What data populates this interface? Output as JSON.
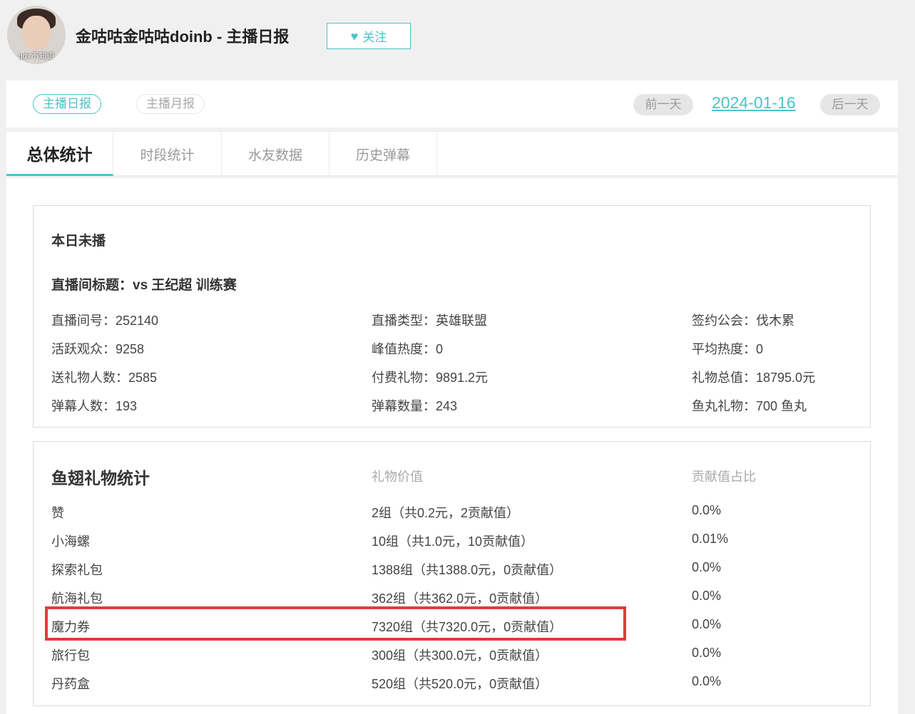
{
  "header": {
    "avatar_caption": "gdx不知道",
    "streamer_title": "金咕咕金咕咕doinb - 主播日报",
    "follow_label": "关注",
    "follow_icon": "heart-icon"
  },
  "report_bar": {
    "daily_tab": "主播日报",
    "monthly_tab": "主播月报",
    "prev_day": "前一天",
    "date": "2024-01-16",
    "next_day": "后一天"
  },
  "tabs": [
    {
      "label": "总体统计",
      "active": true
    },
    {
      "label": "时段统计",
      "active": false
    },
    {
      "label": "水友数据",
      "active": false
    },
    {
      "label": "历史弹幕",
      "active": false
    }
  ],
  "overview": {
    "status": "本日未播",
    "room_title": "直播间标题：vs 王纪超 训练赛",
    "stats": [
      [
        "直播间号：252140",
        "直播类型：英雄联盟",
        "签约公会：伐木累"
      ],
      [
        "活跃观众：9258",
        "峰值热度：0",
        "平均热度：0"
      ],
      [
        "送礼物人数：2585",
        "付费礼物：9891.2元",
        "礼物总值：18795.0元"
      ],
      [
        "弹幕人数：193",
        "弹幕数量：243",
        "鱼丸礼物：700 鱼丸"
      ]
    ]
  },
  "gift_stats": {
    "heading": "鱼翅礼物统计",
    "col_value": "礼物价值",
    "col_ratio": "贡献值占比",
    "rows": [
      {
        "name": "赞",
        "value": "2组（共0.2元，2贡献值）",
        "ratio": "0.0%"
      },
      {
        "name": "小海螺",
        "value": "10组（共1.0元，10贡献值）",
        "ratio": "0.01%"
      },
      {
        "name": "探索礼包",
        "value": "1388组（共1388.0元，0贡献值）",
        "ratio": "0.0%"
      },
      {
        "name": "航海礼包",
        "value": "362组（共362.0元，0贡献值）",
        "ratio": "0.0%"
      },
      {
        "name": "魔力券",
        "value": "7320组（共7320.0元，0贡献值）",
        "ratio": "0.0%",
        "highlighted": true
      },
      {
        "name": "旅行包",
        "value": "300组（共300.0元，0贡献值）",
        "ratio": "0.0%"
      },
      {
        "name": "丹药盒",
        "value": "520组（共520.0元，0贡献值）",
        "ratio": "0.0%"
      }
    ]
  },
  "colors": {
    "accent": "#4cc3c8",
    "highlight_border": "#e13b3b"
  }
}
